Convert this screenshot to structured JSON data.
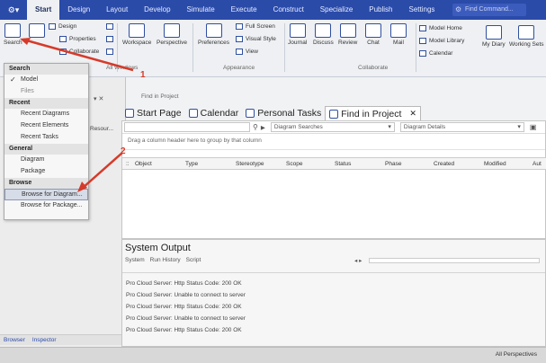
{
  "ribbon_tabs": [
    "Start",
    "Design",
    "Layout",
    "Develop",
    "Simulate",
    "Execute",
    "Construct",
    "Specialize",
    "Publish",
    "Settings"
  ],
  "active_tab": "Start",
  "find_command": "Find Command...",
  "ribbon": {
    "search": "Search",
    "design": "Design",
    "properties": "Properties",
    "collaborate": "Collaborate",
    "workspace": "Workspace",
    "perspective": "Perspective",
    "all_windows": "All Windows",
    "preferences": "Preferences",
    "full_screen": "Full Screen",
    "visual_style": "Visual Style",
    "view": "View",
    "appearance": "Appearance",
    "journal": "Journal",
    "discuss": "Discuss",
    "review": "Review",
    "chat": "Chat",
    "mail": "Mail",
    "collaborate_group": "Collaborate",
    "model_home": "Model Home",
    "model_library": "Model Library",
    "calendar": "Calendar",
    "my_diary": "My Diary",
    "working_sets": "Working Sets"
  },
  "menu": {
    "search_header": "Search",
    "model": "Model",
    "files": "Files",
    "recent_header": "Recent",
    "recent_diagrams": "Recent Diagrams",
    "recent_elements": "Recent Elements",
    "recent_tasks": "Recent Tasks",
    "general_header": "General",
    "diagram": "Diagram",
    "package": "Package",
    "browse_header": "Browse",
    "browse_diagram": "Browse for Diagram...",
    "browse_package": "Browse for Package..."
  },
  "left_panel": {
    "resources": "Resour...",
    "browser_tab": "Browser",
    "inspector_tab": "Inspector"
  },
  "path_text": "Find in Project",
  "doc_tabs": [
    "Start Page",
    "Calendar",
    "Personal Tasks",
    "Find in Project"
  ],
  "find": {
    "search_select": "Diagram Searches",
    "details_select": "Diagram Details",
    "group_hint": "Drag a column header here to group by that column",
    "columns": [
      "Object",
      "Type",
      "Stereotype",
      "Scope",
      "Status",
      "Phase",
      "Created",
      "Modified",
      "Aut"
    ]
  },
  "output": {
    "title": "System Output",
    "tabs": [
      "System",
      "Run History",
      "Script"
    ],
    "lines": [
      "Pro Cloud Server: Http Status Code: 200 OK",
      "Pro Cloud Server: Unable to connect to server",
      "Pro Cloud Server: Http Status Code: 200 OK",
      "Pro Cloud Server: Unable to connect to server",
      "Pro Cloud Server: Http Status Code: 200 OK"
    ]
  },
  "status": {
    "perspectives": "All Perspectives"
  },
  "annotations": {
    "one": "1",
    "two": "2"
  },
  "colors": {
    "ribbon_bar": "#2b4ba9",
    "annotation": "#d63a2a"
  }
}
